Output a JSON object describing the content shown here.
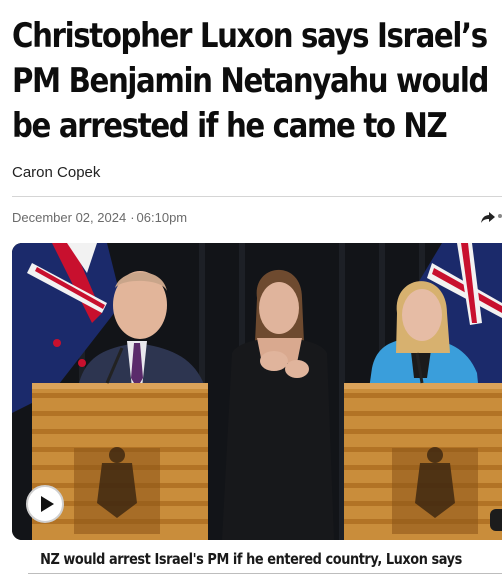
{
  "article": {
    "headline": "Christopher Luxon says Israel’s PM Benjamin Netanyahu would be arrested if he came to NZ",
    "author": "Caron Copek",
    "date": "December 02, 2024",
    "time": "06:10pm",
    "separator": "·"
  },
  "video": {
    "caption": "NZ would arrest Israel's PM if he entered country, Luxon says",
    "play_icon": "play-icon",
    "share_icon": "share-arrow-icon"
  },
  "colors": {
    "headline": "#0d0d0d",
    "meta": "#6b6b6b",
    "divider": "#d5d5d5"
  }
}
